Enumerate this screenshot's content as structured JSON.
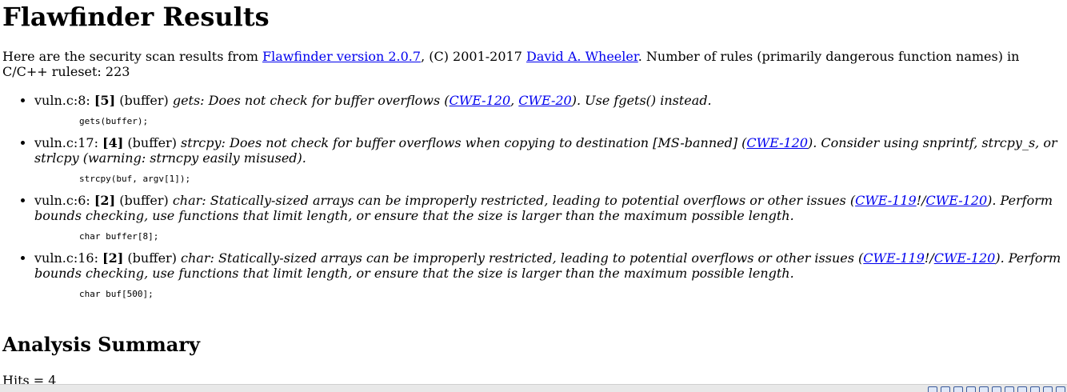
{
  "page": {
    "title": "Flawfinder Results",
    "intro": {
      "prefix": "Here are the security scan results from ",
      "link1": "Flawfinder version 2.0.7",
      "middle": ", (C) 2001-2017 ",
      "link2": "David A. Wheeler",
      "suffix": ". Number of rules (primarily dangerous function names) in C/C++ ruleset: 223"
    }
  },
  "hits": [
    {
      "location": "vuln.c:8: ",
      "level": "[5]",
      "category": " (buffer) ",
      "desc_before": "gets: Does not check for buffer overflows (",
      "cwe1": "CWE-120",
      "sep": ", ",
      "cwe2": "CWE-20",
      "desc_after": "). Use fgets() instead.",
      "code": "gets(buffer);"
    },
    {
      "location": "vuln.c:17: ",
      "level": "[4]",
      "category": " (buffer) ",
      "desc_before": "strcpy: Does not check for buffer overflows when copying to destination [MS-banned] (",
      "cwe1": "CWE-120",
      "desc_after": "). Consider using snprintf, strcpy_s, or strlcpy (warning: strncpy easily misused).",
      "code": "strcpy(buf, argv[1]);"
    },
    {
      "location": "vuln.c:6: ",
      "level": "[2]",
      "category": " (buffer) ",
      "desc_before": "char: Statically-sized arrays can be improperly restricted, leading to potential overflows or other issues (",
      "cwe1": "CWE-119",
      "sep": "!/",
      "cwe2": "CWE-120",
      "desc_after": "). Perform bounds checking, use functions that limit length, or ensure that the size is larger than the maximum possible length.",
      "code": "char buffer[8];"
    },
    {
      "location": "vuln.c:16: ",
      "level": "[2]",
      "category": " (buffer) ",
      "desc_before": "char: Statically-sized arrays can be improperly restricted, leading to potential overflows or other issues (",
      "cwe1": "CWE-119",
      "sep": "!/",
      "cwe2": "CWE-120",
      "desc_after": "). Perform bounds checking, use functions that limit length, or ensure that the size is larger than the maximum possible length.",
      "code": "char buf[500];"
    }
  ],
  "summary": {
    "heading": "Analysis Summary",
    "hits_line": "Hits = 4"
  },
  "statusbar": {
    "icons": [
      "tray-icon-1",
      "tray-icon-2",
      "tray-icon-3",
      "tray-icon-4",
      "tray-icon-5",
      "tray-icon-6",
      "tray-icon-7",
      "tray-icon-8",
      "tray-icon-9",
      "tray-icon-10",
      "tray-icon-11"
    ]
  },
  "colors": {
    "link": "#0000ee",
    "background": "#ffffff",
    "statusbar": "#e8e8e8"
  }
}
